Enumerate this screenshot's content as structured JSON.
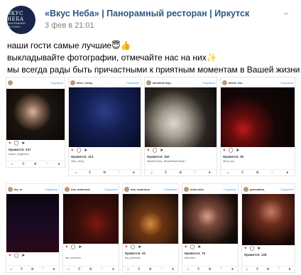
{
  "post": {
    "group_name": "«Вкус Неба» | Панорамный ресторан | Иркутск",
    "date": "3 фев в 21:01",
    "avatar_title": "ВКУС НЕБА",
    "avatar_subtitle": "ПАНОРАМНЫЙ РЕСТОРАН",
    "text_lines": [
      "наши гости самые лучшие😇👍",
      "выкладывайте фотографии, отмечайте нас на них✨",
      "мы всегда рады быть причастными к приятным моментам в Вашей жизни"
    ]
  },
  "icons": {
    "more": "chevron-down-icon",
    "like": "heart-icon",
    "comment": "comment-icon",
    "share": "share-icon",
    "home": "home-icon",
    "search": "search-icon",
    "add": "add-icon",
    "activity": "heart-outline-icon",
    "profile": "profile-icon"
  },
  "glyphs": {
    "more": "⌄",
    "like": "♥",
    "comment": "◯",
    "share": "➤",
    "home": "⌂",
    "search": "⚲",
    "add": "⊕",
    "activity": "♡",
    "profile": "●"
  },
  "screenshots": [
    {
      "user": "",
      "follow": "Подписки",
      "likes": "Нравится: 247",
      "caption": "lyubov_sergeevna"
    },
    {
      "user": "alice_meng",
      "follow": "Подписки",
      "likes": "Нравится: 110",
      "caption": "alice_meng"
    },
    {
      "user": "alexandr.foya_",
      "follow": "Подписки",
      "likes": "Нравится: 162",
      "caption": "alexandr.foya_ Волшебный вечер..."
    },
    {
      "user": "alena_chu",
      "follow": "Подписки",
      "likes": "Нравится: 35",
      "caption": "alena_chu"
    },
    {
      "user": "lily_m",
      "follow": "Подписки",
      "likes": "",
      "caption": ""
    },
    {
      "user": "lisa_marinova",
      "follow": "Подписки",
      "likes": "",
      "caption": "lisa_marinova"
    },
    {
      "user": "lisa_marinova",
      "follow": "Подписки",
      "likes": "Нравится: 42",
      "caption": "lisa_marinova"
    },
    {
      "user": "brian.leko",
      "follow": "Подписки",
      "likes": "Нравится: 75",
      "caption": "brian.leko"
    },
    {
      "user": "",
      "follow": "Подписки",
      "likes": "Нравится: 53",
      "caption": ""
    },
    {
      "user": "gennadiea_",
      "follow": "Подписки",
      "likes": "Нравится: 128",
      "caption": ""
    }
  ]
}
